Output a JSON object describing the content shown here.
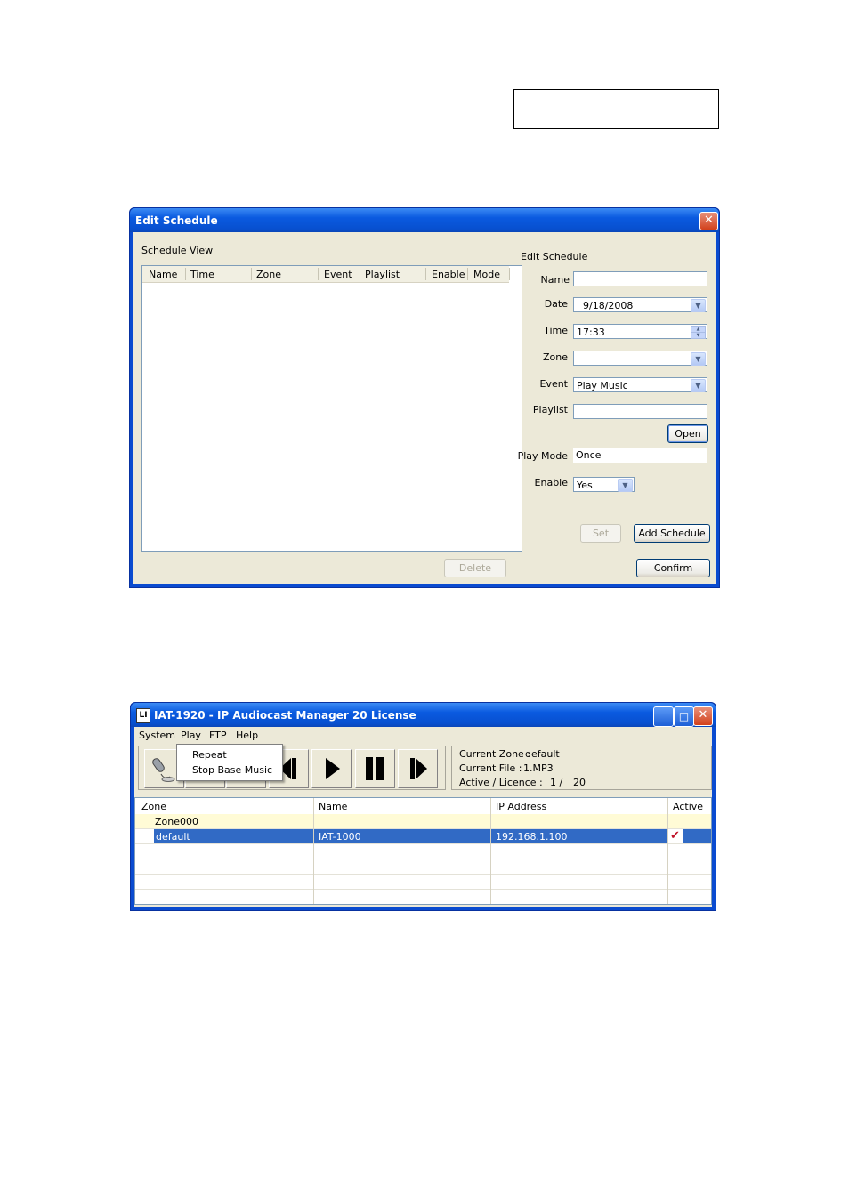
{
  "edit_schedule": {
    "title": "Edit Schedule",
    "close": "✕",
    "schedule_view_label": "Schedule View",
    "columns": [
      "Name",
      "Time",
      "Zone",
      "Event",
      "Playlist",
      "Enable",
      "Mode"
    ],
    "edit_schedule_label": "Edit Schedule",
    "fields": {
      "name_label": "Name",
      "name_value": "",
      "date_label": "Date",
      "date_value": "9/18/2008",
      "time_label": "Time",
      "time_value": "17:33",
      "zone_label": "Zone",
      "zone_value": "",
      "event_label": "Event",
      "event_value": "Play Music",
      "playlist_label": "Playlist",
      "playlist_value": "",
      "play_mode_label": "Play Mode",
      "play_mode_value": "Once",
      "enable_label": "Enable",
      "enable_value": "Yes"
    },
    "buttons": {
      "open": "Open",
      "set": "Set",
      "add_schedule": "Add Schedule",
      "delete": "Delete",
      "confirm": "Confirm"
    }
  },
  "audiocast": {
    "title": "IAT-1920 - IP Audiocast Manager 20 License",
    "app_icon": "LI",
    "window_buttons": {
      "minimize": "_",
      "maximize": "□",
      "close": "✕"
    },
    "menu": [
      "System",
      "Play",
      "FTP",
      "Help"
    ],
    "play_menu_items": [
      "Repeat",
      "Stop Base Music"
    ],
    "info": {
      "current_zone_label": "Current Zone :",
      "current_zone_value": "default",
      "current_file_label": "Current File :",
      "current_file_value": "1.MP3",
      "active_licence_label": "Active / Licence :",
      "active_value": "1 /",
      "licence_value": "20"
    },
    "grid_columns": [
      "Zone",
      "Name",
      "IP Address",
      "Active"
    ],
    "rows": [
      {
        "zone": "Zone000",
        "name": "",
        "ip": "",
        "active": ""
      },
      {
        "zone": "default",
        "name": "IAT-1000",
        "ip": "192.168.1.100",
        "active": "✔"
      }
    ],
    "icons": [
      "microphone-icon",
      "previous-icon",
      "play-icon",
      "pause-icon",
      "next-icon"
    ]
  },
  "colors": {
    "xp_blue": "#0a5ae0",
    "dialog_bg": "#ece9d8",
    "selection": "#316ac5",
    "group_row": "#fffbd6"
  }
}
